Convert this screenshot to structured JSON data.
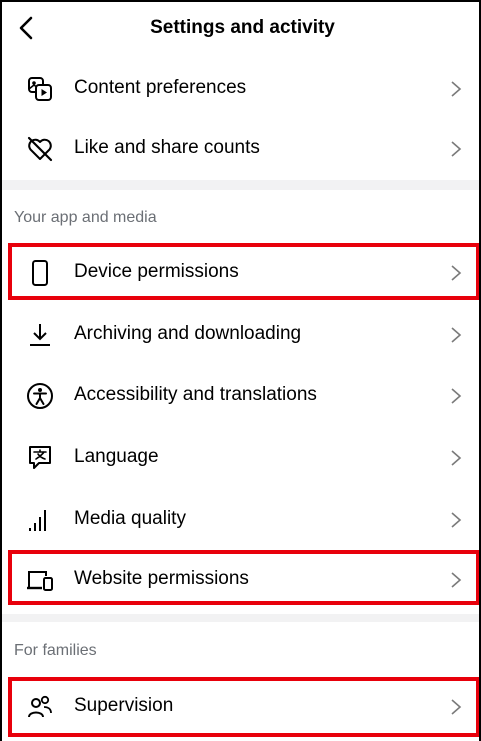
{
  "header": {
    "title": "Settings and activity"
  },
  "sections": {
    "app_media": "Your app and media",
    "families": "For families"
  },
  "items": [
    {
      "label": "Content preferences",
      "icon": "content-preferences-icon"
    },
    {
      "label": "Like and share counts",
      "icon": "heart-slash-icon"
    },
    {
      "label": "Device permissions",
      "icon": "phone-icon"
    },
    {
      "label": "Archiving and downloading",
      "icon": "download-icon"
    },
    {
      "label": "Accessibility and translations",
      "icon": "accessibility-icon"
    },
    {
      "label": "Language",
      "icon": "language-icon"
    },
    {
      "label": "Media quality",
      "icon": "signal-bars-icon"
    },
    {
      "label": "Website permissions",
      "icon": "laptop-phone-icon"
    },
    {
      "label": "Supervision",
      "icon": "people-icon"
    }
  ],
  "highlight_color": "#e8000b"
}
